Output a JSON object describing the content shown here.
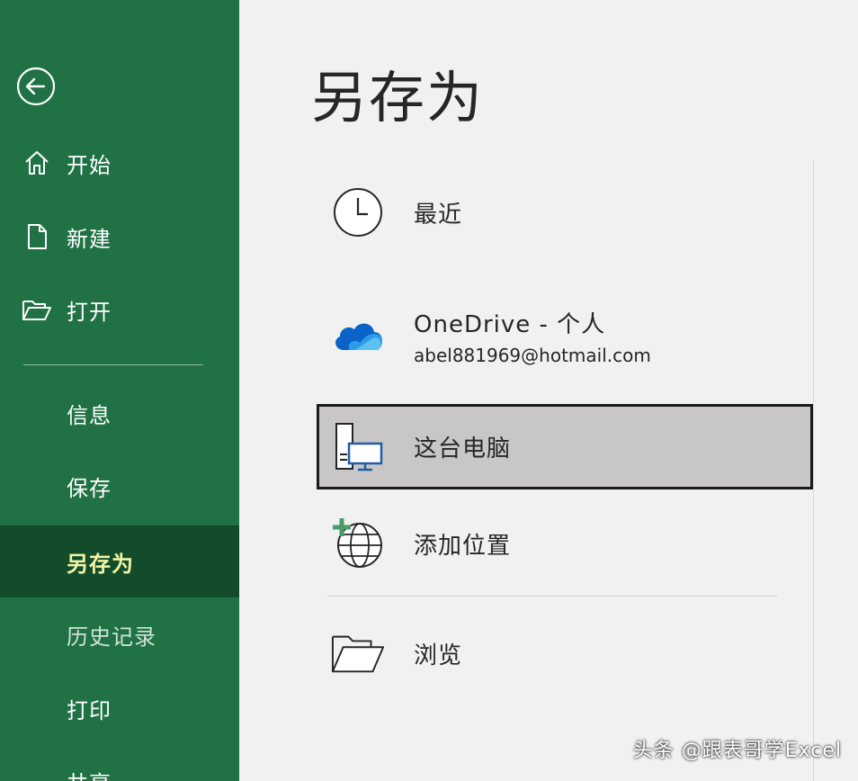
{
  "sidebar": {
    "items": [
      {
        "label": "开始",
        "icon": "home-icon"
      },
      {
        "label": "新建",
        "icon": "new-file-icon"
      },
      {
        "label": "打开",
        "icon": "open-folder-icon"
      },
      {
        "label": "信息"
      },
      {
        "label": "保存"
      },
      {
        "label": "另存为",
        "active": true
      },
      {
        "label": "历史记录",
        "muted": true
      },
      {
        "label": "打印"
      },
      {
        "label": "共享"
      }
    ]
  },
  "main": {
    "title": "另存为",
    "locations": [
      {
        "title": "最近",
        "icon": "clock-icon"
      },
      {
        "title": "OneDrive - 个人",
        "subtitle": "abel881969@hotmail.com",
        "icon": "onedrive-cloud-icon"
      },
      {
        "title": "这台电脑",
        "icon": "this-pc-icon",
        "selected": true
      },
      {
        "title": "添加位置",
        "icon": "add-location-globe-icon"
      },
      {
        "title": "浏览",
        "icon": "browse-folder-icon"
      }
    ]
  },
  "watermark": "头条 @跟表哥学Excel",
  "colors": {
    "sidebar_bg": "#207245",
    "sidebar_active_bg": "#124c2a",
    "active_text": "#f3f3a6",
    "main_bg": "#f1f1f1",
    "selected_bg": "#c8c6c6",
    "onedrive_blue": "#0a64c8"
  }
}
